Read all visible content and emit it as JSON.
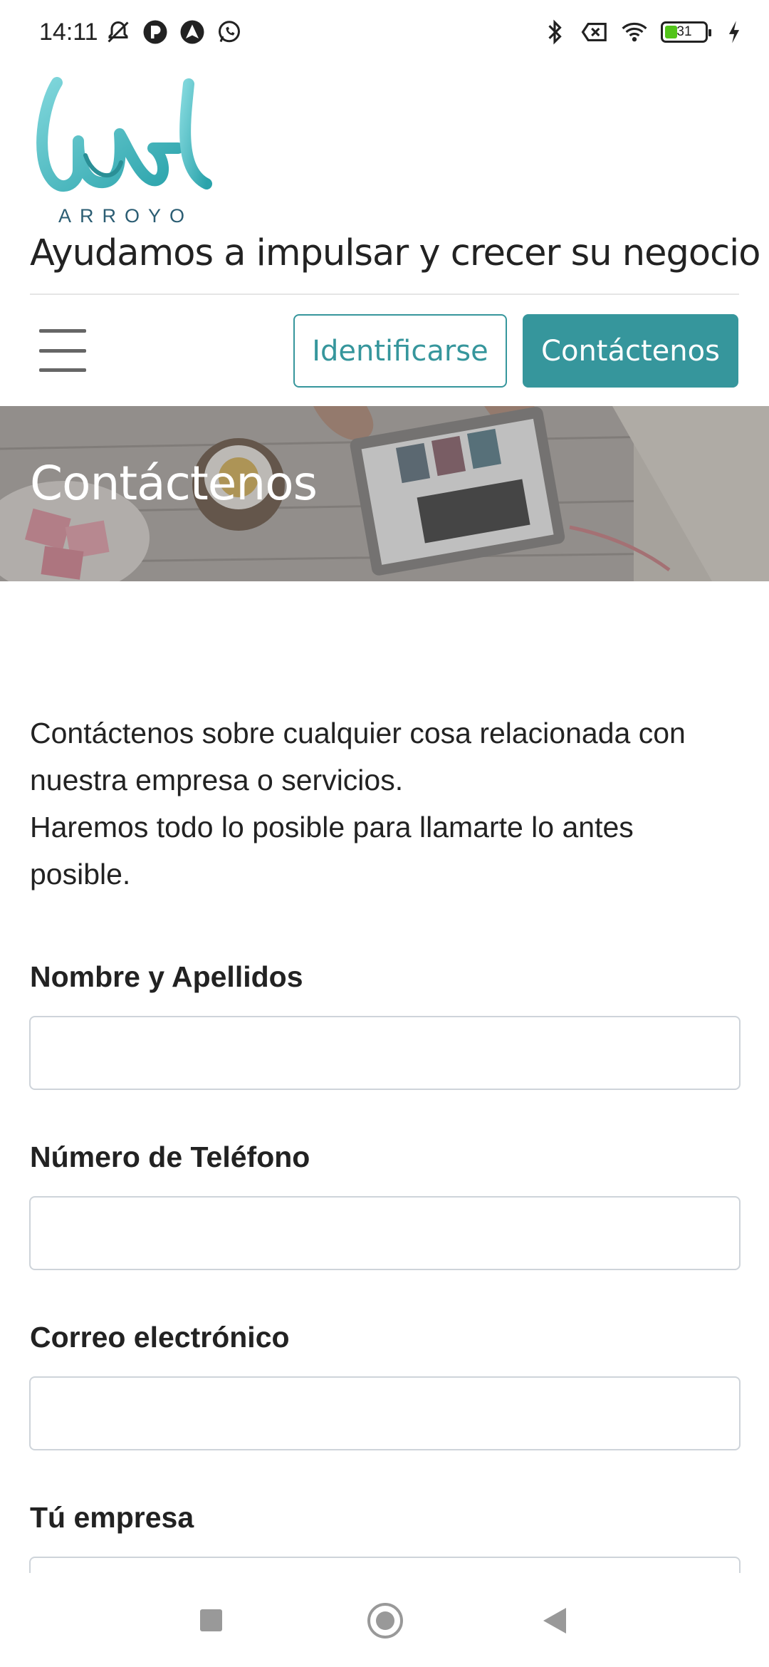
{
  "status_bar": {
    "time": "14:11",
    "battery_level": "31",
    "icons_left": [
      "mute-bell-icon",
      "app-notification-icon",
      "navigation-app-icon",
      "whatsapp-icon"
    ],
    "icons_right": [
      "bluetooth-icon",
      "no-sim-icon",
      "wifi-icon",
      "battery-icon",
      "charging-icon"
    ]
  },
  "header": {
    "logo_subtitle": "ARROYO",
    "tagline": "Ayudamos a impulsar y crecer su negocio",
    "login_button": "Identificarse",
    "contact_button": "Contáctenos"
  },
  "hero": {
    "title": "Contáctenos"
  },
  "content": {
    "intro_line1": "Contáctenos sobre cualquier cosa relacionada con nuestra empresa o servicios.",
    "intro_line2": "Haremos todo lo posible para llamarte lo antes posible.",
    "fields": [
      {
        "label": "Nombre y Apellidos",
        "value": ""
      },
      {
        "label": "Número de Teléfono",
        "value": ""
      },
      {
        "label": "Correo electrónico",
        "value": ""
      },
      {
        "label": "Tú empresa",
        "value": ""
      }
    ]
  },
  "colors": {
    "accent": "#36969c",
    "logo": "#5cc3c8"
  }
}
